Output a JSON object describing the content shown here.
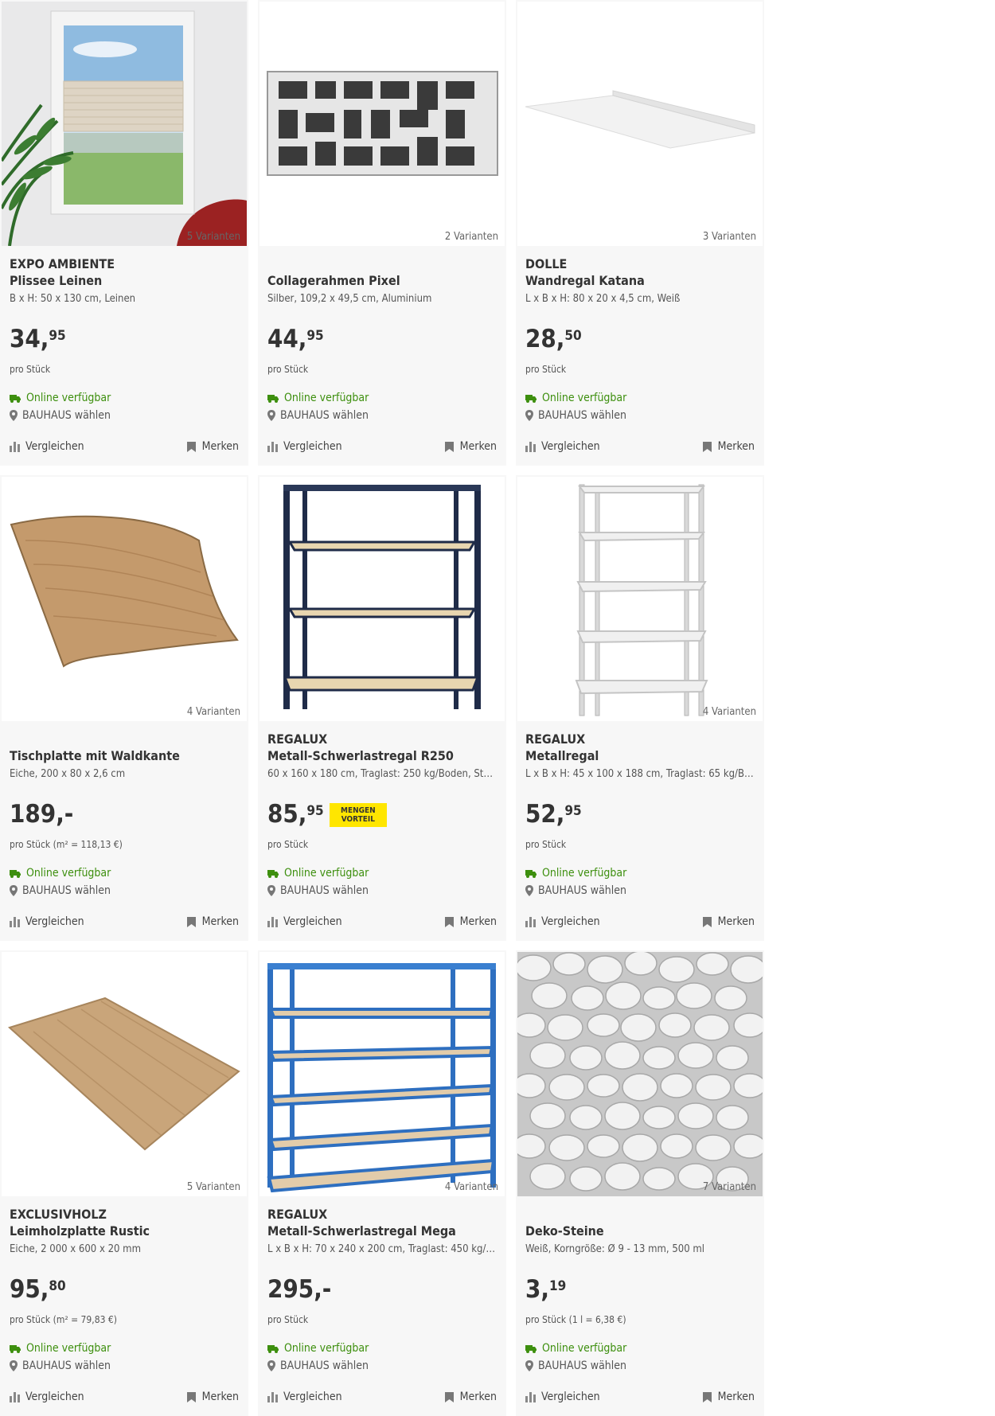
{
  "common": {
    "online_label": "Online verfügbar",
    "store_label": "BAUHAUS wählen",
    "compare_label": "Vergleichen",
    "remember_label": "Merken",
    "online_color": "#3d8f0e",
    "badge_color": "#ffe600"
  },
  "products": [
    {
      "variants": "5 Varianten",
      "brand": "EXPO AMBIENTE",
      "name": "Plissee Leinen",
      "desc": "B x H: 50 x 130 cm, Leinen",
      "price_main": "34,",
      "price_sup": "95",
      "unit": "pro Stück",
      "image": "window-pleated-blind"
    },
    {
      "variants": "2 Varianten",
      "brand": "",
      "name": "Collagerahmen Pixel",
      "desc": "Silber, 109,2 x 49,5 cm, Aluminium",
      "price_main": "44,",
      "price_sup": "95",
      "unit": "pro Stück",
      "image": "photo-collage-frame"
    },
    {
      "variants": "3 Varianten",
      "brand": "DOLLE",
      "name": "Wandregal Katana",
      "desc": "L x B x H: 80 x 20 x 4,5 cm, Weiß",
      "price_main": "28,",
      "price_sup": "50",
      "unit": "pro Stück",
      "image": "white-wall-shelf"
    },
    {
      "variants": "4 Varianten",
      "brand": "",
      "name": "Tischplatte mit Waldkante",
      "desc": "Eiche, 200 x 80 x 2,6 cm",
      "price_main": "189,-",
      "price_sup": "",
      "unit": "pro Stück (m² = 118,13 €)",
      "image": "live-edge-tabletop"
    },
    {
      "variants": "",
      "brand": "REGALUX",
      "name": "Metall-Schwerlastregal R250",
      "desc": "60 x 160 x 180 cm, Traglast: 250 kg/Boden, Stec...",
      "price_main": "85,",
      "price_sup": "95",
      "unit": "pro Stück",
      "badge_line1": "MENGEN",
      "badge_line2": "VORTEIL",
      "image": "dark-metal-shelf"
    },
    {
      "variants": "4 Varianten",
      "brand": "REGALUX",
      "name": "Metallregal",
      "desc": "L x B x H: 45 x 100 x 188 cm, Traglast: 65 kg/Bo...",
      "price_main": "52,",
      "price_sup": "95",
      "unit": "pro Stück",
      "image": "white-metal-shelf"
    },
    {
      "variants": "5 Varianten",
      "brand": "EXCLUSIVHOLZ",
      "name": "Leimholzplatte Rustic",
      "desc": "Eiche, 2 000 x 600 x 20 mm",
      "price_main": "95,",
      "price_sup": "80",
      "unit": "pro Stück (m² = 79,83 €)",
      "image": "oak-panel"
    },
    {
      "variants": "4 Varianten",
      "brand": "REGALUX",
      "name": "Metall-Schwerlastregal Mega",
      "desc": "L x B x H: 70 x 240 x 200 cm, Traglast: 450 kg/B...",
      "price_main": "295,-",
      "price_sup": "",
      "unit": "pro Stück",
      "image": "blue-heavy-shelf"
    },
    {
      "variants": "7 Varianten",
      "brand": "",
      "name": "Deko-Steine",
      "desc": "Weiß, Korngröße: Ø 9 - 13 mm, 500 ml",
      "price_main": "3,",
      "price_sup": "19",
      "unit": "pro Stück (1 l = 6,38 €)",
      "image": "white-pebbles"
    }
  ]
}
